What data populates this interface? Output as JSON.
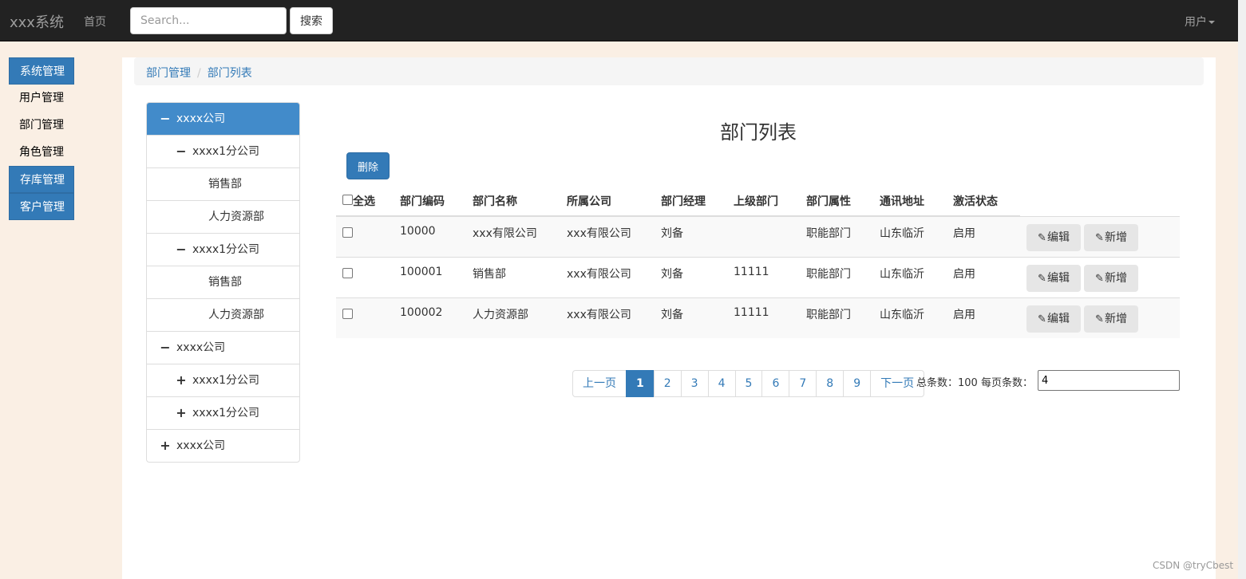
{
  "navbar": {
    "brand": "xxx系统",
    "home": "首页",
    "search_placeholder": "Search...",
    "search_button": "搜索",
    "user": "用户"
  },
  "sidebar": {
    "items": [
      {
        "label": "系统管理",
        "type": "group"
      },
      {
        "label": "用户管理",
        "type": "sub"
      },
      {
        "label": "部门管理",
        "type": "sub"
      },
      {
        "label": "角色管理",
        "type": "sub"
      },
      {
        "label": "存库管理",
        "type": "group"
      },
      {
        "label": "客户管理",
        "type": "group"
      }
    ]
  },
  "breadcrumb": {
    "items": [
      "部门管理",
      "部门列表"
    ],
    "separator": "/"
  },
  "tree": {
    "nodes": [
      {
        "label": "xxxx公司",
        "glyph": "minus",
        "level": 0,
        "active": true
      },
      {
        "label": "xxxx1分公司",
        "glyph": "minus",
        "level": 1,
        "active": false
      },
      {
        "label": "销售部",
        "glyph": "",
        "level": 2,
        "active": false
      },
      {
        "label": "人力资源部",
        "glyph": "",
        "level": 2,
        "active": false
      },
      {
        "label": "xxxx1分公司",
        "glyph": "minus",
        "level": 1,
        "active": false
      },
      {
        "label": "销售部",
        "glyph": "",
        "level": 2,
        "active": false
      },
      {
        "label": "人力资源部",
        "glyph": "",
        "level": 2,
        "active": false
      },
      {
        "label": "xxxx公司",
        "glyph": "minus",
        "level": 0,
        "active": false
      },
      {
        "label": "xxxx1分公司",
        "glyph": "plus",
        "level": 1,
        "active": false
      },
      {
        "label": "xxxx1分公司",
        "glyph": "plus",
        "level": 1,
        "active": false
      },
      {
        "label": "xxxx公司",
        "glyph": "plus",
        "level": 0,
        "active": false
      }
    ]
  },
  "content": {
    "title": "部门列表",
    "delete_button": "删除",
    "headers": [
      "全选",
      "部门编码",
      "部门名称",
      "所属公司",
      "部门经理",
      "上级部门",
      "部门属性",
      "通讯地址",
      "激活状态"
    ],
    "rows": [
      [
        "10000",
        "xxx有限公司",
        "xxx有限公司",
        "刘备",
        "",
        "职能部门",
        "山东临沂",
        "启用"
      ],
      [
        "100001",
        "销售部",
        "xxx有限公司",
        "刘备",
        "11111",
        "职能部门",
        "山东临沂",
        "启用"
      ],
      [
        "100002",
        "人力资源部",
        "xxx有限公司",
        "刘备",
        "11111",
        "职能部门",
        "山东临沂",
        "启用"
      ]
    ],
    "edit_label": "编辑",
    "add_label": "新增"
  },
  "pagination": {
    "prev": "上一页",
    "pages": [
      "1",
      "2",
      "3",
      "4",
      "5",
      "6",
      "7",
      "8",
      "9"
    ],
    "active_page": "1",
    "next": "下一页",
    "total_text": "总条数：100 每页条数：",
    "page_size_value": "4"
  },
  "watermark": "CSDN @tryCbest",
  "colors": {
    "primary": "#337ab7",
    "tree_active": "#428bca",
    "navbar": "#222222",
    "page_bg": "#faefe4"
  }
}
